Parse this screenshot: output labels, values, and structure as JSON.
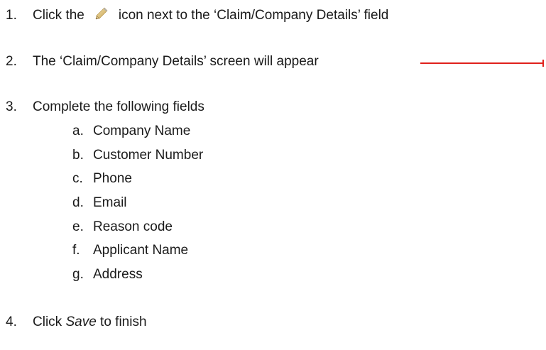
{
  "steps": {
    "s1": {
      "num": "1.",
      "pre": "Click the",
      "post": "icon next to the ‘Claim/Company Details’ field",
      "icon": "pencil-icon"
    },
    "s2": {
      "num": "2.",
      "text": "The ‘Claim/Company Details’ screen will appear"
    },
    "s3": {
      "num": "3.",
      "text": "Complete the following fields"
    },
    "s4": {
      "num": "4.",
      "pre": "Click",
      "action": "Save",
      "post": "to finish"
    }
  },
  "fields": [
    {
      "letter": "a.",
      "label": "Company Name"
    },
    {
      "letter": "b.",
      "label": "Customer Number"
    },
    {
      "letter": "c.",
      "label": "Phone"
    },
    {
      "letter": "d.",
      "label": "Email"
    },
    {
      "letter": "e.",
      "label": "Reason code"
    },
    {
      "letter": "f.",
      "label": "Applicant Name"
    },
    {
      "letter": "g.",
      "label": "Address"
    }
  ],
  "colors": {
    "text": "#1a1a1a",
    "arrow": "#e0201b"
  }
}
